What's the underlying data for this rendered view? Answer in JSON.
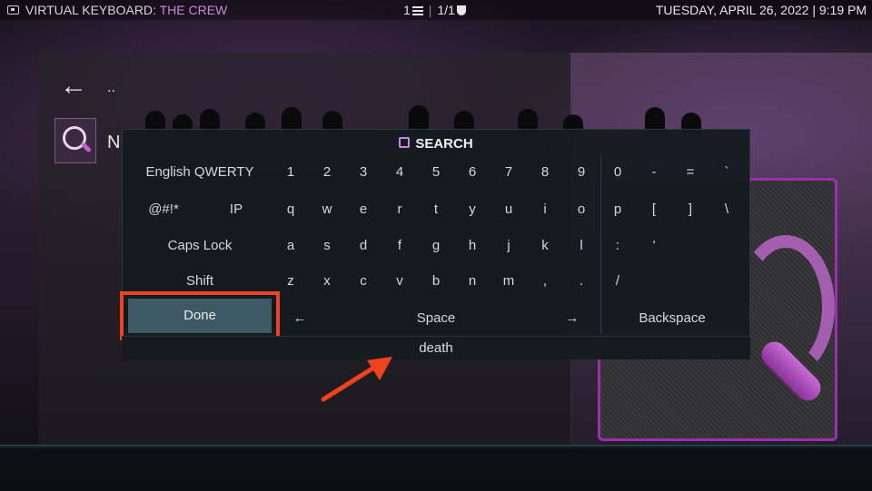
{
  "topbar": {
    "title_prefix": "VIRTUAL KEYBOARD: ",
    "title_accent": "THE CREW",
    "list_count": "1",
    "page_info": "1/1",
    "datetime": "TUESDAY, APRIL 26, 2022 | 9:19 PM"
  },
  "nav": {
    "back_dots": ".."
  },
  "left_item": {
    "name_initial": "N"
  },
  "keyboard": {
    "title": "SEARCH",
    "rows": [
      [
        "English QWERTY",
        "1",
        "2",
        "3",
        "4",
        "5",
        "6",
        "7",
        "8",
        "9",
        "0",
        "-",
        "=",
        "`"
      ],
      [
        "@#!*",
        "IP",
        "q",
        "w",
        "e",
        "r",
        "t",
        "y",
        "u",
        "i",
        "o",
        "p",
        "[",
        "]",
        "\\"
      ],
      [
        "Caps Lock",
        "a",
        "s",
        "d",
        "f",
        "g",
        "h",
        "j",
        "k",
        "l",
        ":",
        "'"
      ],
      [
        "Shift",
        "z",
        "x",
        "c",
        "v",
        "b",
        "n",
        "m",
        ",",
        ".",
        "/"
      ]
    ],
    "done": "Done",
    "left_arrow": "←",
    "space": "Space",
    "right_arrow": "→",
    "backspace": "Backspace",
    "input_value": "death"
  },
  "colors": {
    "accent_purple": "#c987e0",
    "highlight_red": "#f0421e",
    "done_bg": "#3e5866"
  }
}
